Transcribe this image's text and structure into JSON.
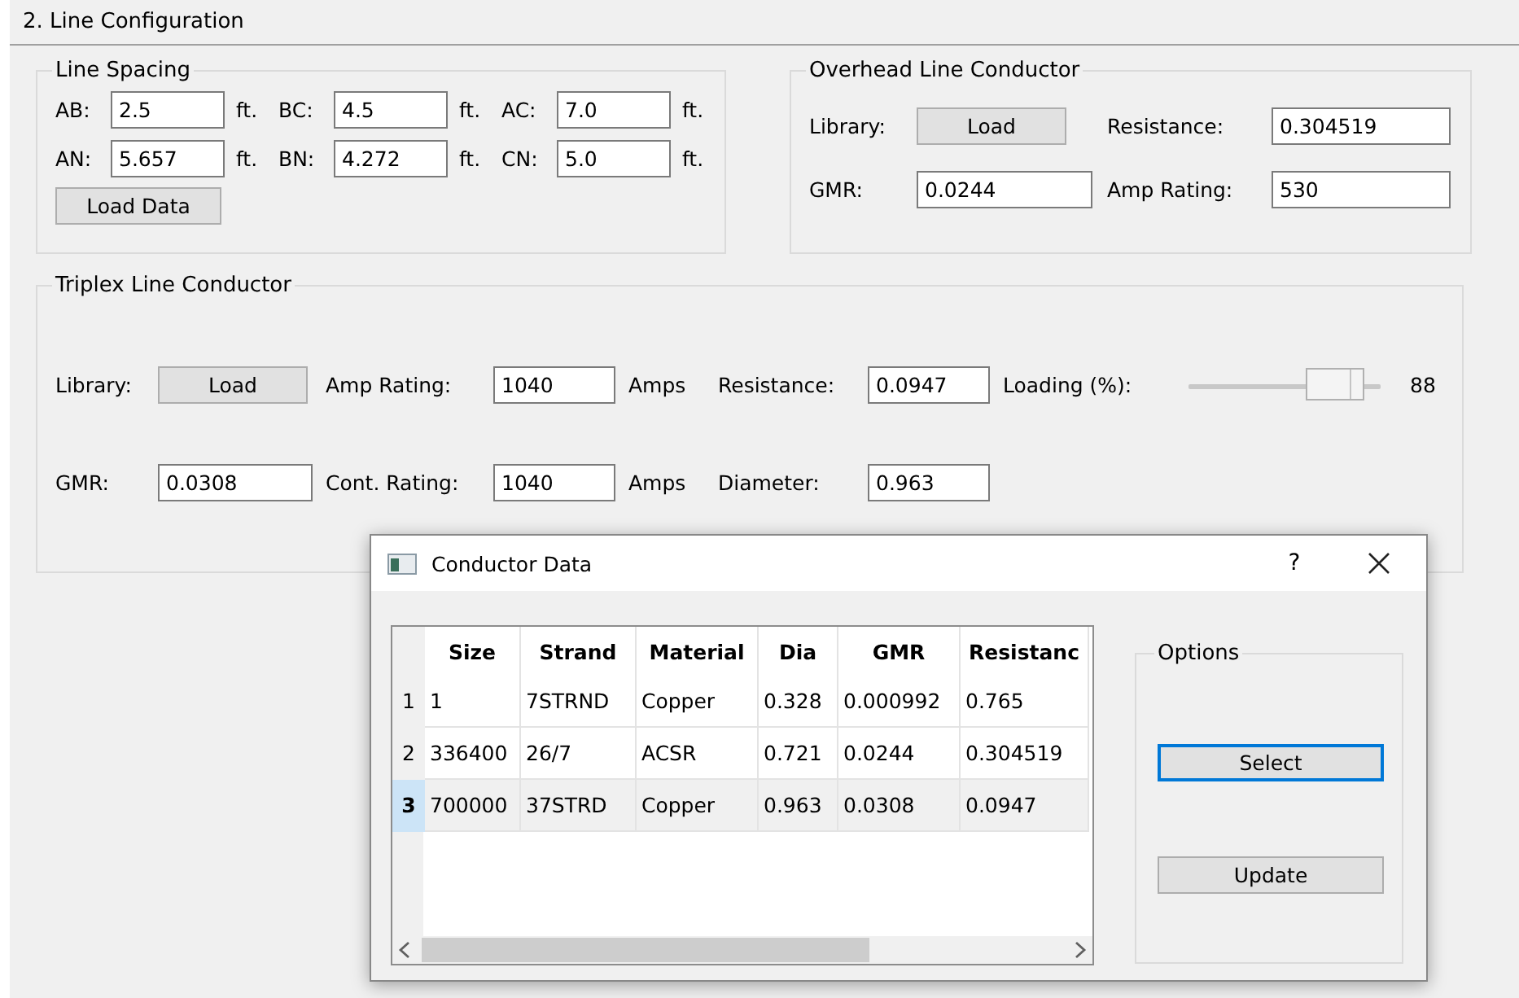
{
  "section_title": "2. Line Configuration",
  "line_spacing": {
    "title": "Line Spacing",
    "rows": [
      [
        {
          "label": "AB:",
          "value": "2.5",
          "unit": "ft."
        },
        {
          "label": "BC:",
          "value": "4.5",
          "unit": "ft."
        },
        {
          "label": "AC:",
          "value": "7.0",
          "unit": "ft."
        }
      ],
      [
        {
          "label": "AN:",
          "value": "5.657",
          "unit": "ft."
        },
        {
          "label": "BN:",
          "value": "4.272",
          "unit": "ft."
        },
        {
          "label": "CN:",
          "value": "5.0",
          "unit": "ft."
        }
      ]
    ],
    "button": "Load Data"
  },
  "overhead": {
    "title": "Overhead Line Conductor",
    "rows": [
      [
        {
          "kind": "label",
          "text": "Library:"
        },
        {
          "kind": "button",
          "text": "Load"
        },
        {
          "kind": "label",
          "text": "Resistance:"
        },
        {
          "kind": "field",
          "text": "0.304519"
        }
      ],
      [
        {
          "kind": "label",
          "text": "GMR:"
        },
        {
          "kind": "field",
          "text": "0.0244"
        },
        {
          "kind": "label",
          "text": "Amp Rating:"
        },
        {
          "kind": "field",
          "text": "530"
        }
      ]
    ]
  },
  "triplex": {
    "title": "Triplex Line Conductor",
    "rows": [
      [
        {
          "kind": "label",
          "text": "Library:"
        },
        {
          "kind": "button",
          "text": "Load"
        },
        {
          "kind": "label",
          "text": "Amp Rating:"
        },
        {
          "kind": "field",
          "text": "1040"
        },
        {
          "kind": "label",
          "text": "Amps"
        },
        {
          "kind": "label",
          "text": "Resistance:"
        },
        {
          "kind": "field",
          "text": "0.0947"
        },
        {
          "kind": "label",
          "text": "Loading (%):"
        },
        {
          "kind": "slider",
          "level": 0.88
        },
        {
          "kind": "label",
          "text": "88"
        }
      ],
      [
        {
          "kind": "label",
          "text": "GMR:"
        },
        {
          "kind": "field",
          "text": "0.0308"
        },
        {
          "kind": "label",
          "text": "Cont. Rating:"
        },
        {
          "kind": "field",
          "text": "1040"
        },
        {
          "kind": "label",
          "text": "Amps"
        },
        {
          "kind": "label",
          "text": "Diameter:"
        },
        {
          "kind": "field",
          "text": "0.963"
        }
      ]
    ]
  },
  "dialog": {
    "title": "Conductor Data",
    "help": "?",
    "table": {
      "columns": [
        "Size",
        "Strand",
        "Material",
        "Dia",
        "GMR",
        "Resistanc"
      ],
      "rows": [
        {
          "number": "1",
          "selected": false,
          "cells": [
            "1",
            "7STRND",
            "Copper",
            "0.328",
            "0.000992",
            "0.765"
          ]
        },
        {
          "number": "2",
          "selected": false,
          "cells": [
            "336400",
            "26/7",
            "ACSR",
            "0.721",
            "0.0244",
            "0.304519"
          ]
        },
        {
          "number": "3",
          "selected": true,
          "cells": [
            "700000",
            "37STRD",
            "Copper",
            "0.963",
            "0.0308",
            "0.0947"
          ]
        }
      ]
    },
    "options": {
      "title": "Options",
      "buttons": [
        {
          "label": "Select",
          "focused": true
        },
        {
          "label": "Update",
          "focused": false
        }
      ]
    }
  }
}
